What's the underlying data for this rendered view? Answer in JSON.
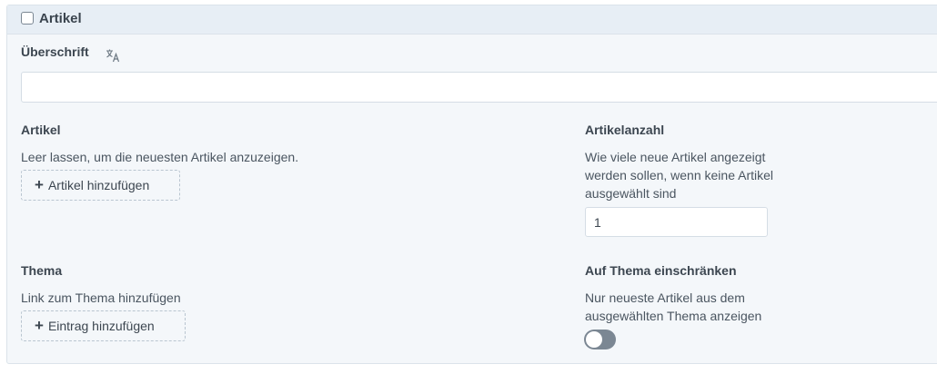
{
  "header": {
    "title": "Artikel"
  },
  "ueberschrift": {
    "label": "Überschrift",
    "value": ""
  },
  "artikel": {
    "label": "Artikel",
    "description": "Leer lassen, um die neuesten Artikel anzuzeigen.",
    "button_label": "Artikel hinzufügen"
  },
  "artikelanzahl": {
    "label": "Artikelanzahl",
    "description_lines": [
      "Wie viele neue Artikel angezeigt",
      "werden sollen, wenn keine Artikel",
      "ausgewählt sind"
    ],
    "value": "1"
  },
  "thema": {
    "label": "Thema",
    "description": "Link zum Thema hinzufügen",
    "button_label": "Eintrag hinzufügen"
  },
  "auf_thema": {
    "label": "Auf Thema einschränken",
    "description_lines": [
      "Nur neueste Artikel aus dem",
      "ausgewählten Thema anzeigen"
    ],
    "toggle_on": false
  },
  "icons": {
    "translate": "translate-icon",
    "plus": "plus-icon",
    "checkbox": "checkbox-icon"
  },
  "colors": {
    "panel_bg": "#f4f7fa",
    "header_bg": "#e7eef5",
    "toggle_off": "#7b8793"
  }
}
